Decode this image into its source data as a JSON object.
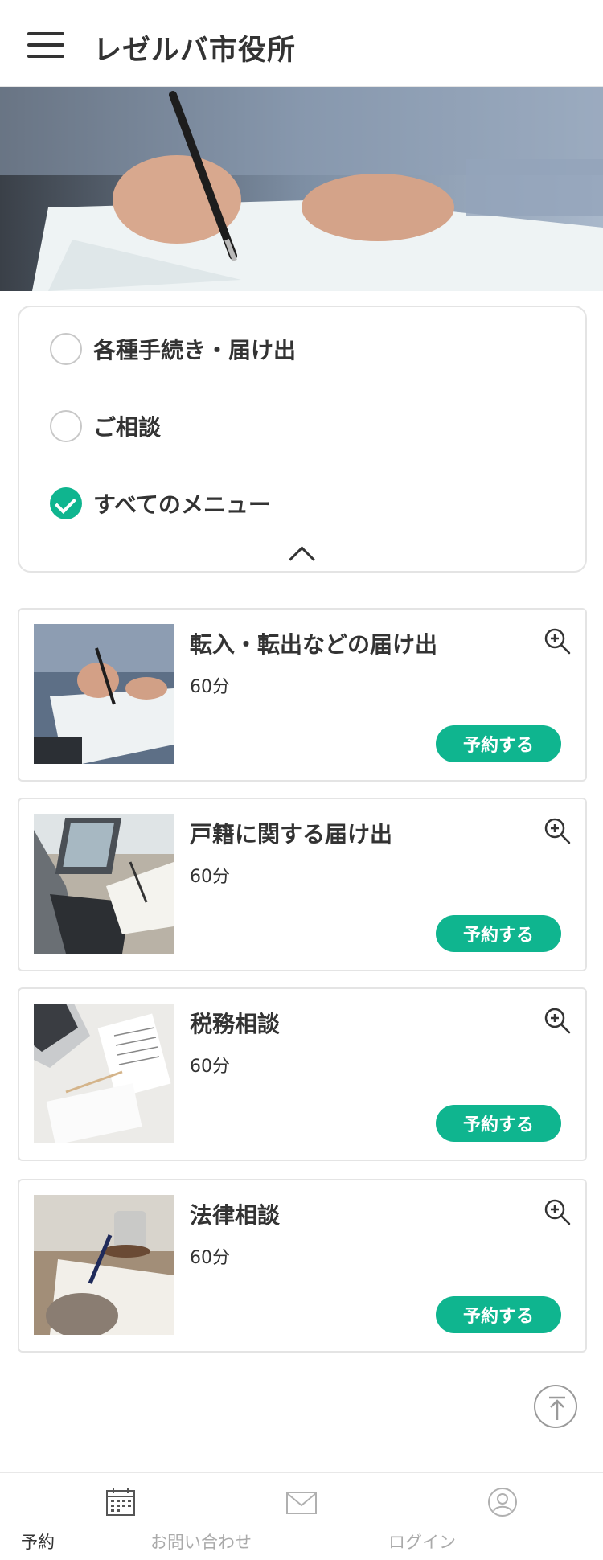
{
  "header": {
    "title": "レゼルバ市役所"
  },
  "filters": [
    {
      "label": "各種手続き・届け出",
      "checked": false
    },
    {
      "label": "ご相談",
      "checked": false
    },
    {
      "label": "すべてのメニュー",
      "checked": true
    }
  ],
  "services": [
    {
      "title": "転入・転出などの届け出",
      "duration": "60分",
      "reserve_label": "予約する"
    },
    {
      "title": "戸籍に関する届け出",
      "duration": "60分",
      "reserve_label": "予約する"
    },
    {
      "title": "税務相談",
      "duration": "60分",
      "reserve_label": "予約する"
    },
    {
      "title": "法律相談",
      "duration": "60分",
      "reserve_label": "予約する"
    }
  ],
  "bottom_nav": [
    {
      "label": "予約",
      "icon": "calendar-icon",
      "active": true
    },
    {
      "label": "お問い合わせ",
      "icon": "mail-icon",
      "active": false
    },
    {
      "label": "ログイン",
      "icon": "user-icon",
      "active": false
    }
  ],
  "colors": {
    "accent": "#0fb58f",
    "text": "#333333",
    "inactive": "#aaaaaa",
    "border": "#e4e4e4"
  }
}
